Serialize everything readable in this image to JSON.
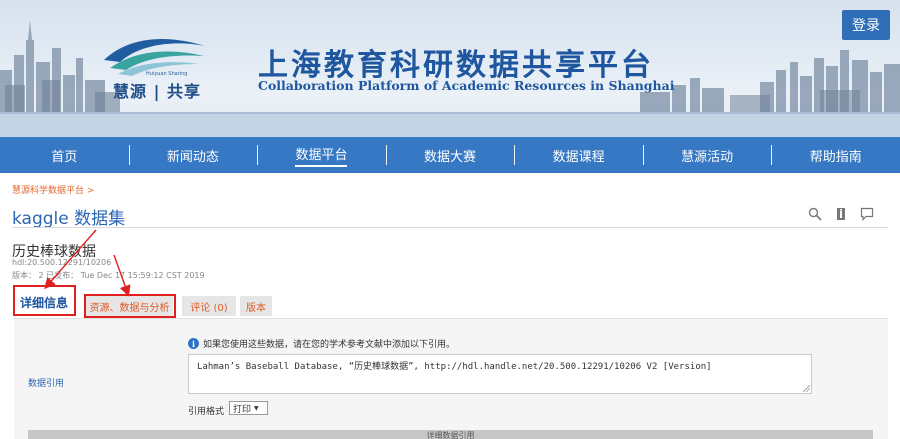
{
  "header": {
    "login_label": "登录",
    "logo_text": "慧源 | 共享",
    "logo_small": "Huiyuan Sharing",
    "title_cn": "上海教育科研数据共享平台",
    "title_en": "Collaboration Platform of Academic Resources in Shanghai"
  },
  "nav": {
    "items": [
      {
        "label": "首页"
      },
      {
        "label": "新闻动态"
      },
      {
        "label": "数据平台",
        "active": true
      },
      {
        "label": "数据大赛"
      },
      {
        "label": "数据课程"
      },
      {
        "label": "慧源活动"
      },
      {
        "label": "帮助指南"
      }
    ]
  },
  "breadcrumb": "慧源科学数据平台 >",
  "collection_title": "kaggle 数据集",
  "item": {
    "title": "历史棒球数据",
    "handle": "hdl:20.500.12291/10206",
    "version_line": "版本： 2 已发布： Tue Dec 17 15:59:12 CST 2019"
  },
  "tabs": {
    "details": "详细信息",
    "resources": "资源、数据与分析",
    "comments": "评论 (0)",
    "versions": "版本"
  },
  "citation": {
    "label": "数据引用",
    "note": "如果您使用这些数据，请在您的学术参考文献中添加以下引用。",
    "text": "Lahman’s Baseball Database, “历史棒球数据”, http://hdl.handle.net/20.500.12291/10206 V2 [Version]",
    "format_label": "引用格式",
    "format_value": "打印",
    "bottom_bar": "详细数据引用"
  },
  "colors": {
    "nav_bg": "#3678c4",
    "accent_blue": "#1e56a0",
    "link_orange": "#e05a2a",
    "annotation_red": "#e02020"
  }
}
